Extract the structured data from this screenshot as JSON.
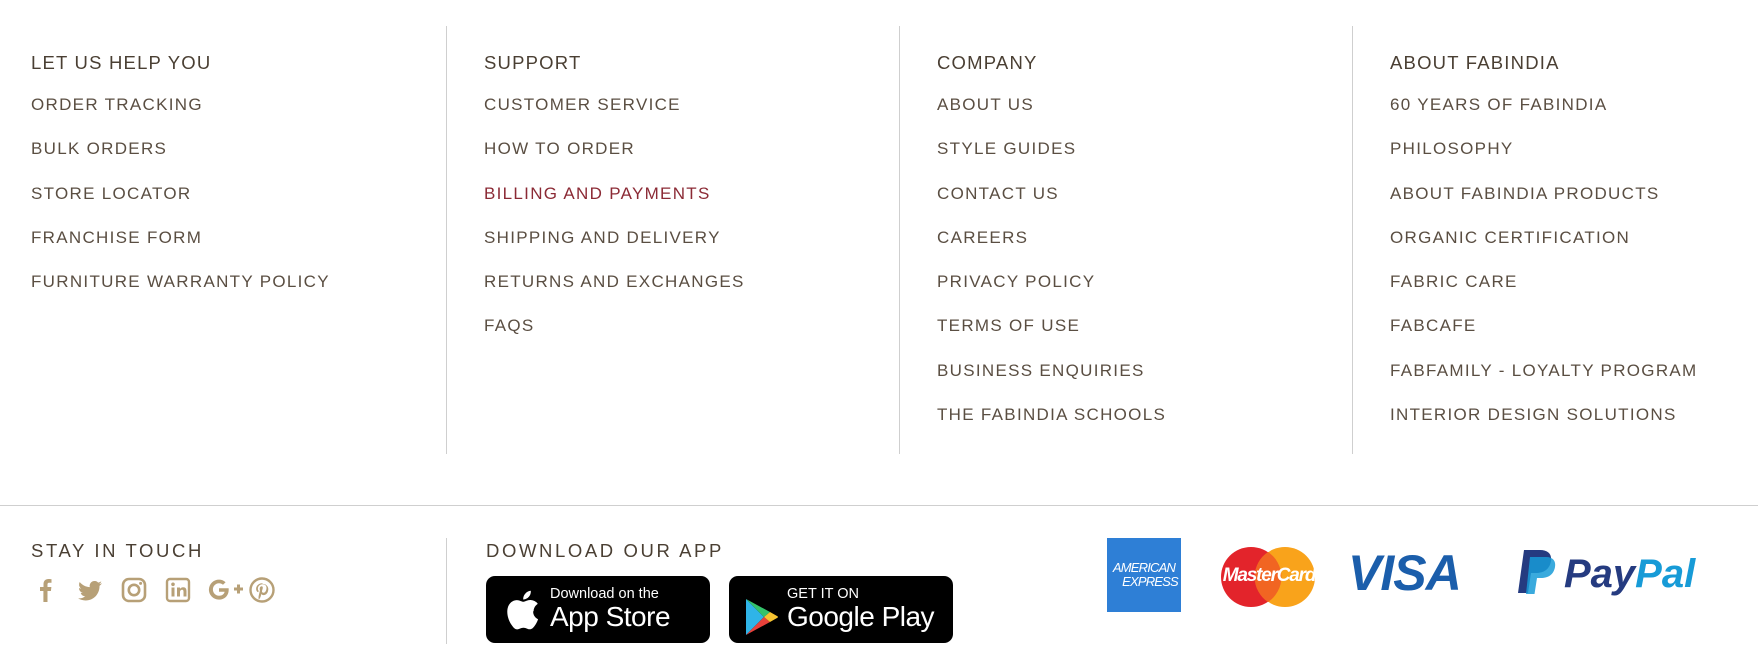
{
  "footer_columns": [
    {
      "title": "LET US HELP YOU",
      "links": [
        "ORDER TRACKING",
        "BULK ORDERS",
        "STORE LOCATOR",
        "FRANCHISE FORM",
        "FURNITURE WARRANTY POLICY"
      ]
    },
    {
      "title": "SUPPORT",
      "links": [
        "CUSTOMER SERVICE",
        "HOW TO ORDER",
        "BILLING AND PAYMENTS",
        "SHIPPING AND DELIVERY",
        "RETURNS AND EXCHANGES",
        "FAQS"
      ],
      "active_link": "BILLING AND PAYMENTS"
    },
    {
      "title": "COMPANY",
      "links": [
        "ABOUT US",
        "STYLE GUIDES",
        "CONTACT US",
        "CAREERS",
        "PRIVACY POLICY",
        "TERMS OF USE",
        "BUSINESS ENQUIRIES",
        "THE FABINDIA SCHOOLS"
      ]
    },
    {
      "title": "ABOUT FABINDIA",
      "links": [
        "60 YEARS OF FABINDIA",
        "PHILOSOPHY",
        "ABOUT FABINDIA PRODUCTS",
        "ORGANIC CERTIFICATION",
        "FABRIC CARE",
        "FABCAFE",
        "FABFAMILY - LOYALTY PROGRAM",
        "INTERIOR DESIGN SOLUTIONS"
      ]
    }
  ],
  "stay_in_touch": {
    "title": "STAY IN TOUCH",
    "icons": [
      "facebook-icon",
      "twitter-icon",
      "instagram-icon",
      "linkedin-icon",
      "google-plus-icon",
      "pinterest-icon"
    ]
  },
  "download_app": {
    "title": "DOWNLOAD OUR APP",
    "app_store": {
      "small": "Download on the",
      "big": "App Store"
    },
    "google_play": {
      "small": "GET IT ON",
      "big": "Google Play"
    }
  },
  "payments": {
    "amex": {
      "line1": "AMERICAN",
      "line2": "EXPRESS"
    },
    "mastercard": "MasterCard",
    "visa": "VISA",
    "paypal": {
      "part1": "Pay",
      "part2": "Pal"
    }
  },
  "colors": {
    "text": "#5a4e42",
    "active_link": "#8b2a35",
    "social_icon": "#b7a077",
    "divider": "#cfcfcf"
  }
}
